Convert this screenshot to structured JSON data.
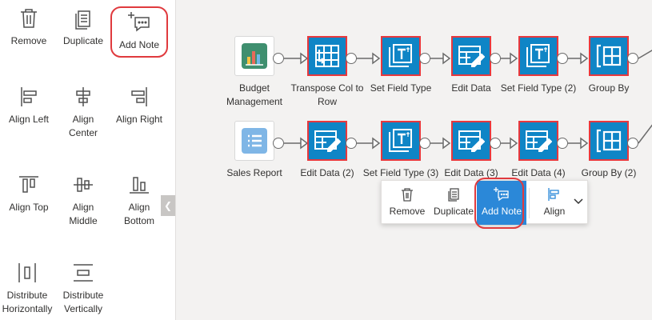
{
  "panel": {
    "tools": [
      {
        "label": "Remove",
        "icon": "trash-icon"
      },
      {
        "label": "Duplicate",
        "icon": "duplicate-icon"
      },
      {
        "label": "Add Note",
        "icon": "add-note-icon"
      },
      {
        "label": "Align Left",
        "icon": "align-left-icon"
      },
      {
        "label": "Align\nCenter",
        "icon": "align-center-icon"
      },
      {
        "label": "Align Right",
        "icon": "align-right-icon"
      },
      {
        "label": "Align Top",
        "icon": "align-top-icon"
      },
      {
        "label": "Align\nMiddle",
        "icon": "align-middle-icon"
      },
      {
        "label": "Align\nBottom",
        "icon": "align-bottom-icon"
      },
      {
        "label": "Distribute\nHorizontally",
        "icon": "distribute-horizontal-icon"
      },
      {
        "label": "Distribute\nVertically",
        "icon": "distribute-vertical-icon"
      }
    ]
  },
  "flow": {
    "row1": [
      {
        "label": "Budget\nManagement",
        "type": "source",
        "icon": "chart-icon"
      },
      {
        "label": "Transpose Col to\nRow",
        "type": "transform",
        "icon": "transpose-icon"
      },
      {
        "label": "Set Field Type",
        "type": "transform",
        "icon": "text-field-icon"
      },
      {
        "label": "Edit Data",
        "type": "transform",
        "icon": "edit-data-icon"
      },
      {
        "label": "Set Field Type (2)",
        "type": "transform",
        "icon": "text-field-icon"
      },
      {
        "label": "Group By",
        "type": "transform",
        "icon": "group-by-icon"
      }
    ],
    "row2": [
      {
        "label": "Sales Report",
        "type": "source",
        "icon": "report-icon"
      },
      {
        "label": "Edit Data (2)",
        "type": "transform",
        "icon": "edit-data-icon"
      },
      {
        "label": "Set Field Type (3)",
        "type": "transform",
        "icon": "text-field-icon"
      },
      {
        "label": "Edit Data (3)",
        "type": "transform",
        "icon": "edit-data-icon"
      },
      {
        "label": "Edit Data (4)",
        "type": "transform",
        "icon": "edit-data-icon"
      },
      {
        "label": "Group By (2)",
        "type": "transform",
        "icon": "group-by-icon"
      }
    ]
  },
  "toolbar": {
    "remove": "Remove",
    "duplicate": "Duplicate",
    "add_note": "Add Note",
    "align": "Align"
  },
  "colors": {
    "node_fill": "#0f85c6",
    "node_border": "#e8383d",
    "highlight": "#e03a3e",
    "active_button": "#2b88d8"
  }
}
